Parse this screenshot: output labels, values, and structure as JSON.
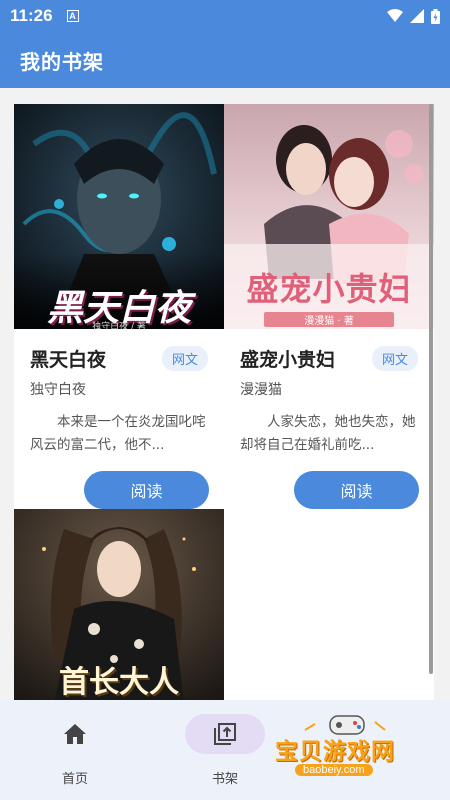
{
  "status": {
    "time": "11:26",
    "a_icon": "A"
  },
  "app": {
    "title": "我的书架"
  },
  "books": [
    {
      "title": "黑天白夜",
      "tag": "网文",
      "author": "独守白夜",
      "desc": "本来是一个在炎龙国叱咤风云的富二代，他不...",
      "read_label": "阅读",
      "cover_title": "黑天白夜",
      "cover_author": "独守白夜 / 著"
    },
    {
      "title": "盛宠小贵妇",
      "tag": "网文",
      "author": "漫漫猫",
      "desc": "人家失恋，她也失恋，她却将自己在婚礼前吃...",
      "read_label": "阅读",
      "cover_title": "盛宠小贵妇",
      "cover_author": "漫漫猫 · 著"
    },
    {
      "cover_title": "首长大人"
    }
  ],
  "nav": [
    {
      "label": "首页",
      "icon": "home-icon"
    },
    {
      "label": "书架",
      "icon": "bookshelf-icon",
      "active": true
    }
  ],
  "watermark": {
    "text": "宝贝游戏网",
    "url": "baobeiy.com"
  }
}
